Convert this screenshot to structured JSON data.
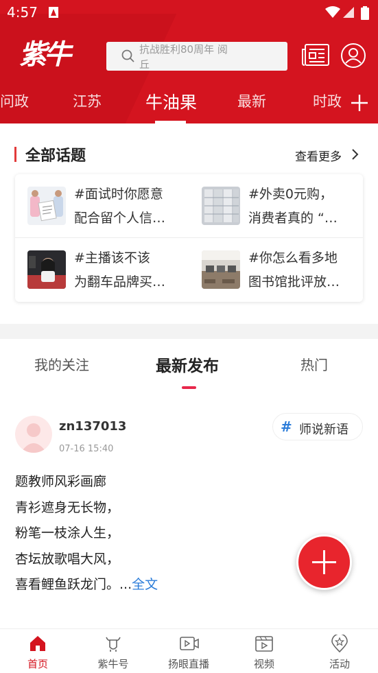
{
  "status_bar": {
    "time": "4:57"
  },
  "header": {
    "logo_text": "紫牛",
    "search_placeholder": "抗战胜利80周年 阅丘",
    "tabs": [
      {
        "label": "问政",
        "active": false
      },
      {
        "label": "江苏",
        "active": false
      },
      {
        "label": "牛油果",
        "active": true
      },
      {
        "label": "最新",
        "active": false
      },
      {
        "label": "时政",
        "active": false
      }
    ]
  },
  "topics": {
    "title": "全部话题",
    "more_label": "查看更多",
    "items": [
      {
        "line1": "#面试时你愿意",
        "line2": "配合留个人信…"
      },
      {
        "line1": "#外卖0元购，",
        "line2": "消费者真的 “…"
      },
      {
        "line1": "#主播该不该",
        "line2": "为翻车品牌买…"
      },
      {
        "line1": "#你怎么看多地",
        "line2": "图书馆批评放…"
      }
    ]
  },
  "feed": {
    "tabs": [
      {
        "label": "我的关注",
        "active": false
      },
      {
        "label": "最新发布",
        "active": true
      },
      {
        "label": "热门",
        "active": false
      }
    ],
    "post": {
      "username": "zn137013",
      "time": "07-16 15:40",
      "tag_hash": "#",
      "tag_label": "师说新语",
      "lines": [
        "题教师风彩画廊",
        "青衫遮身无长物，",
        "粉笔一枝涂人生，",
        "杏坛放歌唱大风，",
        "喜看鲤鱼跃龙门。..."
      ],
      "full_text_label": "全文"
    }
  },
  "bottom_nav": [
    {
      "label": "首页",
      "icon": "home-icon",
      "active": true
    },
    {
      "label": "紫牛号",
      "icon": "bull-icon",
      "active": false
    },
    {
      "label": "扬眼直播",
      "icon": "live-icon",
      "active": false
    },
    {
      "label": "视频",
      "icon": "video-icon",
      "active": false
    },
    {
      "label": "活动",
      "icon": "activity-icon",
      "active": false
    }
  ],
  "colors": {
    "brand_red": "#d4141f",
    "link_blue": "#2b7cd9",
    "fab_red": "#e8252d"
  }
}
